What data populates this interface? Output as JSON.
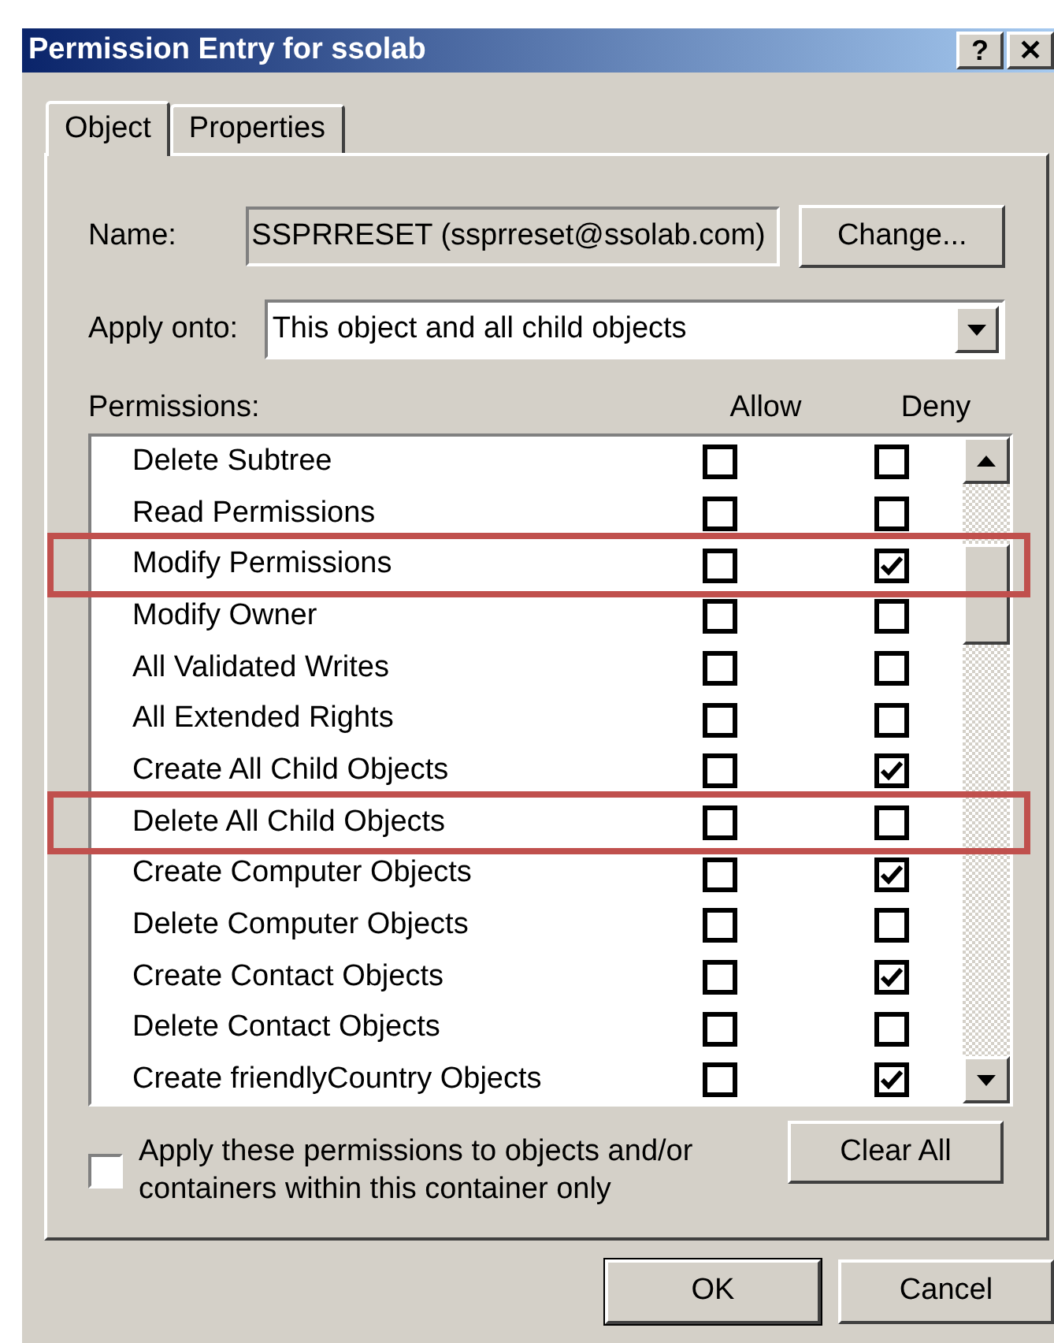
{
  "window": {
    "title": "Permission Entry for ssolab",
    "title_buttons": [
      "?",
      "✕"
    ]
  },
  "tabs": [
    {
      "label": "Object",
      "selected": true
    },
    {
      "label": "Properties",
      "selected": false
    }
  ],
  "name": {
    "label": "Name:",
    "value": "SSPRRESET (ssprreset@ssolab.com)",
    "button": "Change..."
  },
  "apply_onto": {
    "label": "Apply onto:",
    "value": "This object and all child objects"
  },
  "permissions": {
    "label": "Permissions:",
    "columns": [
      "Allow",
      "Deny"
    ],
    "rows": [
      {
        "name": "Delete Subtree",
        "allow": false,
        "deny": false,
        "highlighted": false
      },
      {
        "name": "Read Permissions",
        "allow": false,
        "deny": false,
        "highlighted": false
      },
      {
        "name": "Modify Permissions",
        "allow": false,
        "deny": true,
        "highlighted": true
      },
      {
        "name": "Modify Owner",
        "allow": false,
        "deny": false,
        "highlighted": false
      },
      {
        "name": "All Validated Writes",
        "allow": false,
        "deny": false,
        "highlighted": false
      },
      {
        "name": "All Extended Rights",
        "allow": false,
        "deny": false,
        "highlighted": false
      },
      {
        "name": "Create All Child Objects",
        "allow": false,
        "deny": true,
        "highlighted": false
      },
      {
        "name": "Delete All Child Objects",
        "allow": false,
        "deny": false,
        "highlighted": true
      },
      {
        "name": "Create Computer Objects",
        "allow": false,
        "deny": true,
        "highlighted": false
      },
      {
        "name": "Delete Computer Objects",
        "allow": false,
        "deny": false,
        "highlighted": false
      },
      {
        "name": "Create Contact Objects",
        "allow": false,
        "deny": true,
        "highlighted": false
      },
      {
        "name": "Delete Contact Objects",
        "allow": false,
        "deny": false,
        "highlighted": false
      },
      {
        "name": "Create friendlyCountry Objects",
        "allow": false,
        "deny": true,
        "highlighted": false
      }
    ]
  },
  "apply_only": {
    "label": "Apply these permissions to objects and/or containers within this container only",
    "checked": false
  },
  "clear_button": "Clear All",
  "buttons": [
    "OK",
    "Cancel"
  ]
}
